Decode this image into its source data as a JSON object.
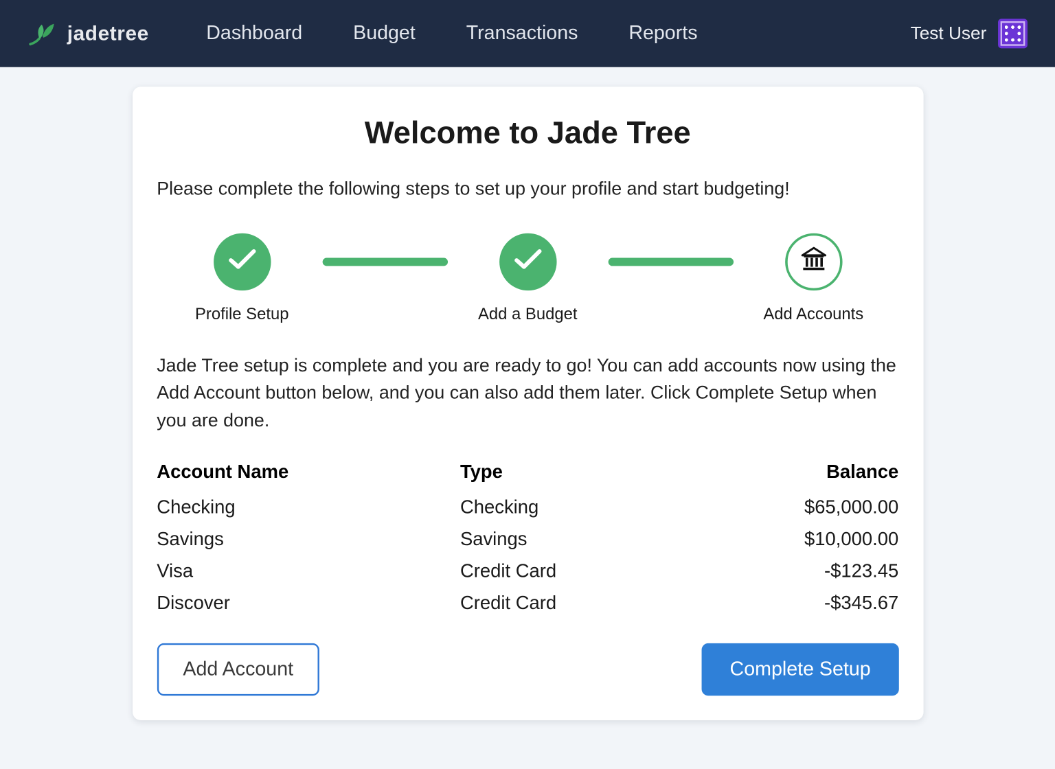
{
  "brand": {
    "name": "jadetree"
  },
  "nav": {
    "links": [
      "Dashboard",
      "Budget",
      "Transactions",
      "Reports"
    ]
  },
  "user": {
    "name": "Test User"
  },
  "card": {
    "title": "Welcome to Jade Tree",
    "subtitle": "Please complete the following steps to set up your profile and start budgeting!",
    "body": "Jade Tree setup is complete and you are ready to go! You can add accounts now using the Add Account button below, and you can also add them later. Click Complete Setup when you are done."
  },
  "steps": [
    {
      "label": "Profile Setup",
      "state": "done"
    },
    {
      "label": "Add a Budget",
      "state": "done"
    },
    {
      "label": "Add Accounts",
      "state": "current"
    }
  ],
  "table": {
    "headers": {
      "name": "Account Name",
      "type": "Type",
      "balance": "Balance"
    },
    "rows": [
      {
        "name": "Checking",
        "type": "Checking",
        "balance": "$65,000.00"
      },
      {
        "name": "Savings",
        "type": "Savings",
        "balance": "$10,000.00"
      },
      {
        "name": "Visa",
        "type": "Credit Card",
        "balance": "-$123.45"
      },
      {
        "name": "Discover",
        "type": "Credit Card",
        "balance": "-$345.67"
      }
    ]
  },
  "actions": {
    "add_account": "Add Account",
    "complete_setup": "Complete Setup"
  }
}
